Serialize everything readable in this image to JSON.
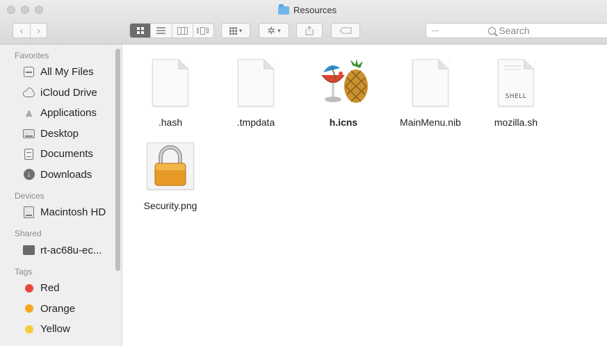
{
  "window": {
    "title": "Resources"
  },
  "toolbar": {
    "back_label": "‹",
    "forward_label": "›",
    "search_placeholder": "Search"
  },
  "sidebar": {
    "sections": [
      {
        "label": "Favorites",
        "items": [
          {
            "label": "All My Files",
            "icon": "all-files-icon"
          },
          {
            "label": "iCloud Drive",
            "icon": "cloud-icon"
          },
          {
            "label": "Applications",
            "icon": "applications-icon"
          },
          {
            "label": "Desktop",
            "icon": "desktop-icon"
          },
          {
            "label": "Documents",
            "icon": "documents-icon"
          },
          {
            "label": "Downloads",
            "icon": "downloads-icon"
          }
        ]
      },
      {
        "label": "Devices",
        "items": [
          {
            "label": "Macintosh HD",
            "icon": "hard-drive-icon"
          }
        ]
      },
      {
        "label": "Shared",
        "items": [
          {
            "label": "rt-ac68u-ec...",
            "icon": "network-computer-icon"
          }
        ]
      },
      {
        "label": "Tags",
        "items": [
          {
            "label": "Red",
            "color": "#e8453c"
          },
          {
            "label": "Orange",
            "color": "#f5a623"
          },
          {
            "label": "Yellow",
            "color": "#f2cf3a"
          }
        ]
      }
    ]
  },
  "files": [
    {
      "name": ".hash",
      "icon": "document-icon"
    },
    {
      "name": ".tmpdata",
      "icon": "document-icon"
    },
    {
      "name": "h.icns",
      "icon": "cocktail-pineapple-icon"
    },
    {
      "name": "MainMenu.nib",
      "icon": "document-icon"
    },
    {
      "name": "mozilla.sh",
      "icon": "shell-script-icon",
      "badge": "SHELL"
    },
    {
      "name": "Security.png",
      "icon": "padlock-icon"
    }
  ]
}
